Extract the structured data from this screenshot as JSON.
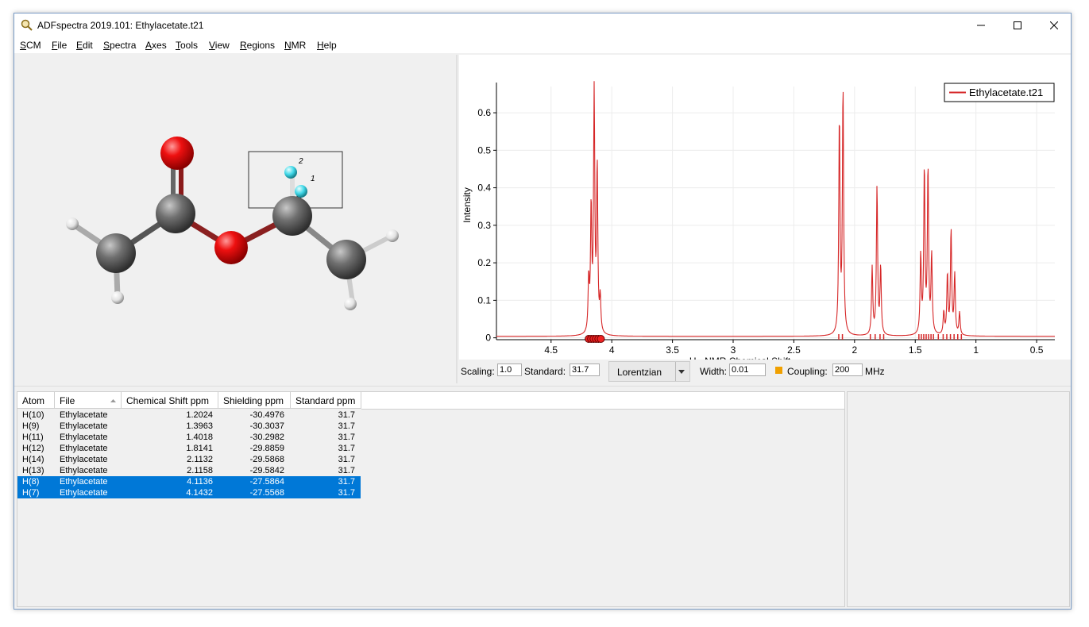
{
  "window": {
    "title": "ADFspectra 2019.101: Ethylacetate.t21"
  },
  "menu": [
    {
      "label": "SCM",
      "ul": "S",
      "rest": "CM"
    },
    {
      "label": "File",
      "ul": "F",
      "rest": "ile"
    },
    {
      "label": "Edit",
      "ul": "E",
      "rest": "dit"
    },
    {
      "label": "Spectra",
      "ul": "S",
      "rest": "pectra"
    },
    {
      "label": "Axes",
      "ul": "A",
      "rest": "xes"
    },
    {
      "label": "Tools",
      "ul": "T",
      "rest": "ools"
    },
    {
      "label": "View",
      "ul": "V",
      "rest": "iew"
    },
    {
      "label": "Regions",
      "ul": "R",
      "rest": "egions"
    },
    {
      "label": "NMR",
      "ul": "N",
      "rest": "MR"
    },
    {
      "label": "Help",
      "ul": "H",
      "rest": "elp"
    }
  ],
  "molecule": {
    "atom_labels": [
      "2",
      "1"
    ]
  },
  "chart_data": {
    "type": "line",
    "xlabel": "H - NMR Chemical Shift",
    "ylabel": "Intensity",
    "xlim": [
      4.95,
      0.35
    ],
    "ylim": [
      -0.005,
      0.67
    ],
    "x_ticks": [
      4.5,
      4,
      3.5,
      3,
      2.5,
      2,
      1.5,
      1,
      0.5
    ],
    "y_ticks": [
      0,
      0.1,
      0.2,
      0.3,
      0.4,
      0.5,
      0.6
    ],
    "x_ticklabels": [
      "4.5",
      "4",
      "3.5",
      "3",
      "2.5",
      "2",
      "1.5",
      "1",
      "0.5"
    ],
    "y_ticklabels": [
      "0",
      "0.1",
      "0.2",
      "0.3",
      "0.4",
      "0.5",
      "0.6"
    ],
    "grid": true,
    "legend_position": "top-right",
    "series": [
      {
        "name": "Ethylacetate.t21",
        "color": "#d62728"
      }
    ],
    "peaks": [
      {
        "x": 4.19,
        "y": 0.14
      },
      {
        "x": 4.17,
        "y": 0.33
      },
      {
        "x": 4.145,
        "y": 0.635
      },
      {
        "x": 4.12,
        "y": 0.44
      },
      {
        "x": 4.095,
        "y": 0.09
      },
      {
        "x": 2.125,
        "y": 0.575
      },
      {
        "x": 2.095,
        "y": 0.655
      },
      {
        "x": 1.855,
        "y": 0.18
      },
      {
        "x": 1.815,
        "y": 0.395
      },
      {
        "x": 1.785,
        "y": 0.18
      },
      {
        "x": 1.455,
        "y": 0.21
      },
      {
        "x": 1.425,
        "y": 0.44
      },
      {
        "x": 1.395,
        "y": 0.44
      },
      {
        "x": 1.365,
        "y": 0.21
      },
      {
        "x": 1.265,
        "y": 0.06
      },
      {
        "x": 1.235,
        "y": 0.16
      },
      {
        "x": 1.205,
        "y": 0.28
      },
      {
        "x": 1.175,
        "y": 0.16
      },
      {
        "x": 1.135,
        "y": 0.06
      }
    ],
    "stick_positions": [
      2.13,
      2.1,
      1.87,
      1.83,
      1.79,
      1.76,
      1.47,
      1.45,
      1.43,
      1.41,
      1.39,
      1.37,
      1.35,
      1.31,
      1.27,
      1.24,
      1.21,
      1.18,
      1.15,
      1.12
    ],
    "marker_positions": [
      4.19,
      4.17,
      4.15,
      4.13,
      4.11,
      4.09
    ]
  },
  "controls": {
    "scaling_label": "Scaling:",
    "scaling_value": "1.0",
    "standard_label": "Standard:",
    "standard_value": "31.7",
    "lineshape": "Lorentzian",
    "width_label": "Width:",
    "width_value": "0.01",
    "coupling_label": "Coupling:",
    "coupling_value": "200",
    "coupling_unit": "MHz",
    "coupling_color": "#f0a000"
  },
  "table": {
    "headers": [
      "Atom",
      "File",
      "Chemical Shift ppm",
      "Shielding ppm",
      "Standard ppm"
    ],
    "rows": [
      [
        "H(10)",
        "Ethylacetate",
        "1.2024",
        "-30.4976",
        "31.7"
      ],
      [
        "H(9)",
        "Ethylacetate",
        "1.3963",
        "-30.3037",
        "31.7"
      ],
      [
        "H(11)",
        "Ethylacetate",
        "1.4018",
        "-30.2982",
        "31.7"
      ],
      [
        "H(12)",
        "Ethylacetate",
        "1.8141",
        "-29.8859",
        "31.7"
      ],
      [
        "H(14)",
        "Ethylacetate",
        "2.1132",
        "-29.5868",
        "31.7"
      ],
      [
        "H(13)",
        "Ethylacetate",
        "2.1158",
        "-29.5842",
        "31.7"
      ],
      [
        "H(8)",
        "Ethylacetate",
        "4.1136",
        "-27.5864",
        "31.7"
      ],
      [
        "H(7)",
        "Ethylacetate",
        "4.1432",
        "-27.5568",
        "31.7"
      ]
    ],
    "selected_rows": [
      6,
      7
    ],
    "selection_color": "#0078d7"
  }
}
